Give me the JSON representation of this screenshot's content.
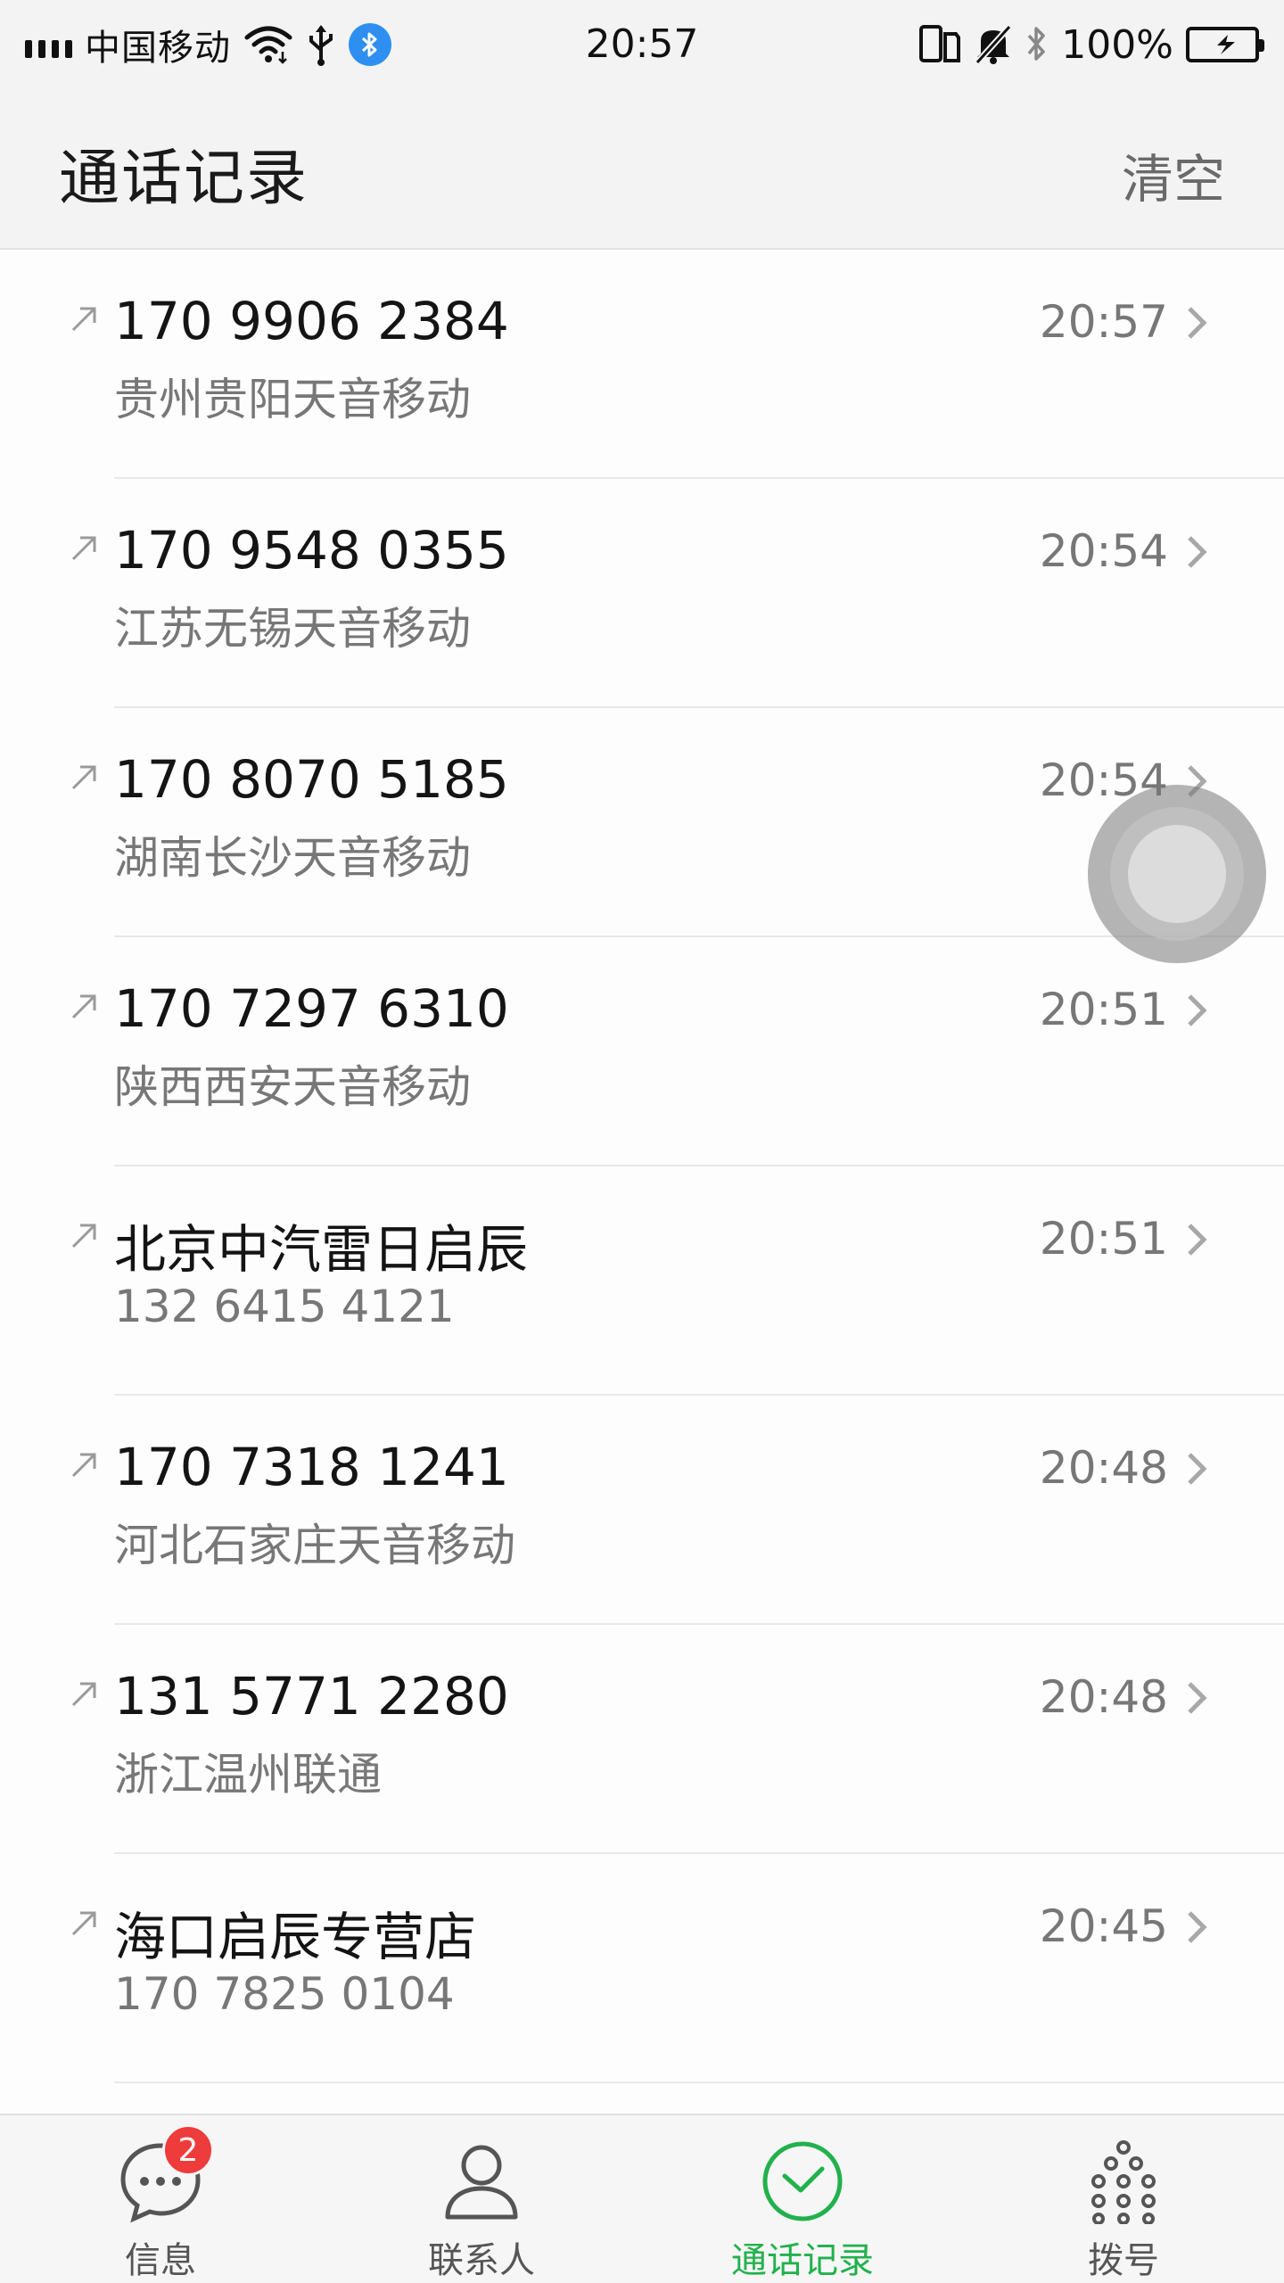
{
  "status_bar": {
    "carrier": "中国移动",
    "time": "20:57",
    "battery_percent": "100%",
    "icons": [
      "signal-icon",
      "wifi-icon",
      "usb-icon",
      "bluetooth-badge-icon",
      "dual-sim-icon",
      "mute-icon",
      "bluetooth-icon",
      "battery-icon"
    ]
  },
  "header": {
    "title": "通话记录",
    "clear_label": "清空"
  },
  "calls": [
    {
      "primary": "170 9906 2384",
      "secondary": "贵州贵阳天音移动",
      "time": "20:57"
    },
    {
      "primary": "170 9548 0355",
      "secondary": "江苏无锡天音移动",
      "time": "20:54"
    },
    {
      "primary": "170 8070 5185",
      "secondary": "湖南长沙天音移动",
      "time": "20:54"
    },
    {
      "primary": "170 7297 6310",
      "secondary": "陕西西安天音移动",
      "time": "20:51"
    },
    {
      "primary": "北京中汽雷日启辰",
      "secondary": "132 6415 4121",
      "time": "20:51"
    },
    {
      "primary": "170 7318 1241",
      "secondary": "河北石家庄天音移动",
      "time": "20:48"
    },
    {
      "primary": "131 5771 2280",
      "secondary": "浙江温州联通",
      "time": "20:48"
    },
    {
      "primary": "海口启辰专营店",
      "secondary": "170 7825 0104",
      "time": "20:45"
    }
  ],
  "bottom_nav": {
    "items": [
      {
        "label": "信息",
        "icon": "message-icon",
        "badge": "2",
        "active": false
      },
      {
        "label": "联系人",
        "icon": "contacts-icon",
        "active": false
      },
      {
        "label": "通话记录",
        "icon": "call-log-icon",
        "active": true
      },
      {
        "label": "拨号",
        "icon": "dialpad-icon",
        "active": false
      }
    ]
  },
  "colors": {
    "accent": "#22b14c",
    "badge": "#ee3b3b",
    "battery": "#37c84a",
    "bluetooth_badge": "#2f8ff0"
  }
}
